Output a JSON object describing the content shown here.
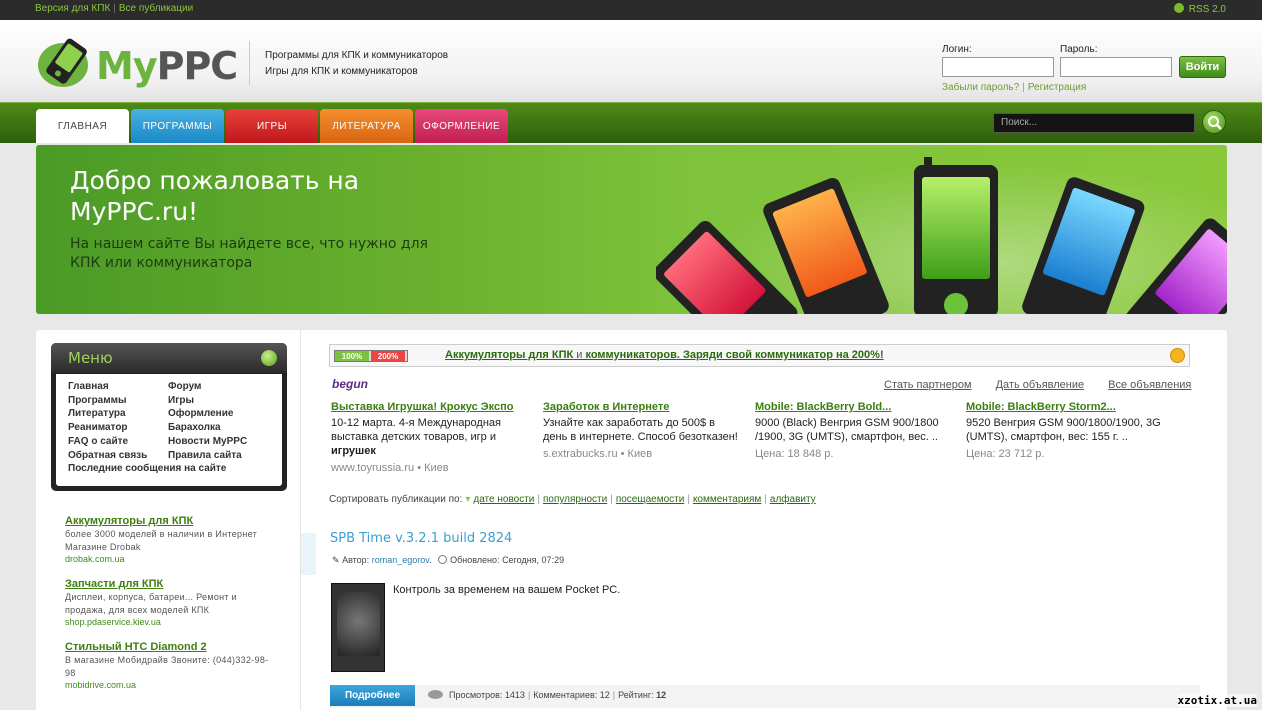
{
  "topbar": {
    "link1": "Версия для КПК",
    "link2": "Все публикации",
    "rss": "RSS 2.0"
  },
  "header": {
    "logo_my": "My",
    "logo_ppc": "PPC",
    "tagline1": "Программы для КПК и коммуникаторов",
    "tagline2": "Игры для КПК и коммуникаторов"
  },
  "login": {
    "login_label": "Логин:",
    "password_label": "Пароль:",
    "submit": "Войти",
    "forgot": "Забыли пароль?",
    "register": "Регистрация"
  },
  "nav": {
    "tabs": [
      {
        "label": "ГЛАВНАЯ",
        "color": "#ffffff"
      },
      {
        "label": "ПРОГРАММЫ",
        "color": "#1b88c6"
      },
      {
        "label": "ИГРЫ",
        "color": "#c0171b"
      },
      {
        "label": "ЛИТЕРАТУРА",
        "color": "#d96512"
      },
      {
        "label": "ОФОРМЛЕНИЕ",
        "color": "#c21f55"
      }
    ],
    "search_placeholder": "Поиск..."
  },
  "banner": {
    "title": "Добро пожаловать на MyPPC.ru!",
    "subtitle": "На нашем сайте Вы найдете все, что нужно для КПК или коммуникатора"
  },
  "menu": {
    "title": "Меню",
    "col1": [
      "Главная",
      "Программы",
      "Литература",
      "Реаниматор",
      "FAQ о сайте",
      "Обратная связь"
    ],
    "col2": [
      "Форум",
      "Игры",
      "Оформление",
      "Барахолка",
      "Новости MyPPC",
      "Правила сайта"
    ],
    "last": "Последние сообщения на сайте"
  },
  "side_ads": [
    {
      "title": "Аккумуляторы для КПК",
      "desc": "более 3000 моделей в наличии в Интернет Магазине Drobak",
      "url": "drobak.com.ua"
    },
    {
      "title": "Запчасти для КПК",
      "desc": "Дисплеи, корпуса, батареи... Ремонт и продажа, для всех моделей КПК",
      "url": "shop.pdaservice.kiev.ua"
    },
    {
      "title": "Стильный HTC Diamond 2",
      "desc": "В магазине Мобидрайв Звоните: (044)332-98-98",
      "url": "mobidrive.com.ua"
    }
  ],
  "ad_bar": {
    "batt_low": "100%",
    "batt_high": "200%",
    "text_a": "Аккумуляторы для КПК",
    "text_k": " и ",
    "text_b": "коммуникаторов. Заряди свой коммуникатор на 200%!"
  },
  "begun": {
    "logo": "begun",
    "links": [
      "Стать партнером",
      "Дать объявление",
      "Все объявления"
    ],
    "ads": [
      {
        "title": "Выставка Игрушка! Крокус Экспо",
        "desc": "10-12 марта. 4-я Международная выставка детских товаров, игр и ",
        "desc_bold": "игрушек",
        "url": "www.toyrussia.ru • Киев"
      },
      {
        "title": "Заработок в Интернете",
        "desc": "Узнайте как заработать до 500$ в день в интернете. Способ безотказен!",
        "desc_bold": "",
        "url": "s.extrabucks.ru • Киев"
      },
      {
        "title": "Mobile: BlackBerry Bold...",
        "desc": "9000 (Black) Венгрия GSM 900/1800 /1900, 3G (UMTS), смартфон, вес. ..",
        "desc_bold": "",
        "url": "Цена: 18 848 р."
      },
      {
        "title": "Mobile: BlackBerry Storm2...",
        "desc": "9520 Венгрия GSM 900/1800/1900, 3G (UMTS), смартфон, вес: 155 г. ..",
        "desc_bold": "",
        "url": "Цена: 23 712 р."
      }
    ]
  },
  "sort": {
    "label": "Сортировать публикации по:",
    "options": [
      "дате новости",
      "популярности",
      "посещаемости",
      "комментариям",
      "алфавиту"
    ]
  },
  "post": {
    "title": "SPB Time v.3.2.1 build 2824",
    "author_label": "Автор:",
    "author": "roman_egorov",
    "updated_label": "Обновлено:",
    "updated": "Сегодня, 07:29",
    "desc": "Контроль за временем на вашем Pocket PC.",
    "more": "Подробнее",
    "views_label": "Просмотров:",
    "views": "1413",
    "comments_label": "Комментариев:",
    "comments": "12",
    "rating_label": "Рейтинг:",
    "rating": "12"
  },
  "watermark": "xzotix.at.ua"
}
